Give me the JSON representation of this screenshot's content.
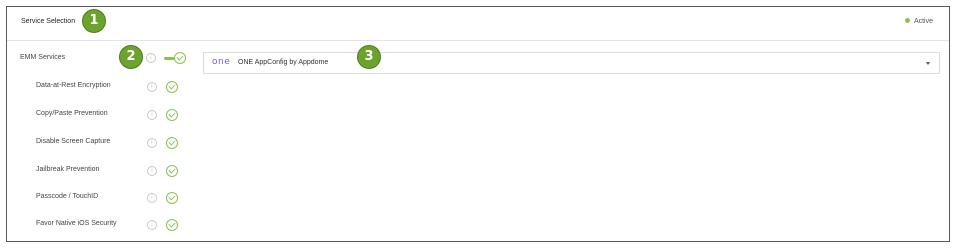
{
  "header": {
    "title": "Service Selection",
    "status": "Active",
    "status_color": "#8cc152"
  },
  "badges": [
    "1",
    "2",
    "3"
  ],
  "emm": {
    "label": "EMM Services",
    "enabled": true
  },
  "select": {
    "logo_text": "one",
    "value": "ONE AppConfig by Appdome"
  },
  "features": [
    {
      "label": "Data-at-Rest Encryption",
      "enabled": true
    },
    {
      "label": "Copy/Paste Prevention",
      "enabled": true
    },
    {
      "label": "Disable Screen Capture",
      "enabled": true
    },
    {
      "label": "Jailbreak Prevention",
      "enabled": true
    },
    {
      "label": "Passcode / TouchID",
      "enabled": true
    },
    {
      "label": "Favor Native iOS Security",
      "enabled": true
    }
  ],
  "colors": {
    "accent": "#8cc152",
    "badge": "#6ba32d",
    "border": "#5a5a5a"
  },
  "icons": {
    "info": "info-circle-icon",
    "check": "check-circle-icon",
    "caret": "caret-down-icon"
  }
}
